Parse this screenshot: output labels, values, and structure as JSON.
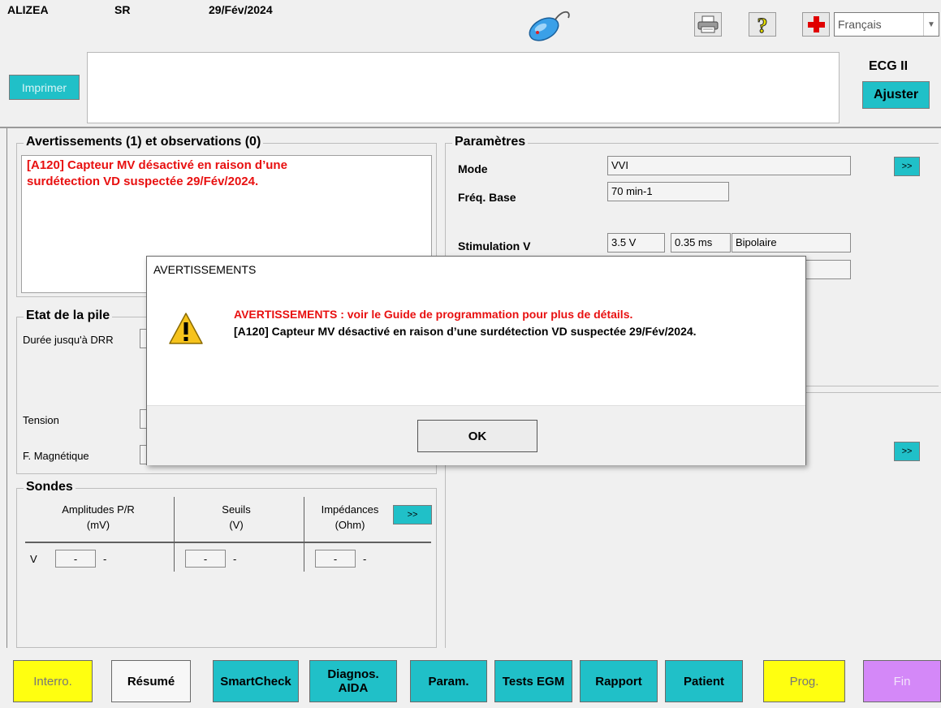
{
  "header": {
    "device_name": "ALIZEA",
    "mode_short": "SR",
    "date": "29/Fév/2024",
    "language": "Français"
  },
  "ecg": {
    "print_label": "Imprimer",
    "lead_label": "ECG II",
    "adjust_label": "Ajuster"
  },
  "warnings": {
    "title": "Avertissements (1) et observations (0)",
    "text_line1": "[A120] Capteur MV désactivé en raison d’une",
    "text_line2": "surdétection VD suspectée 29/Fév/2024."
  },
  "parameters": {
    "title": "Paramètres",
    "expand_label": ">>",
    "mode_label": "Mode",
    "mode_value": "VVI",
    "rate_label": "Fréq. Base",
    "rate_value": "70 min-1",
    "pacing_label": "Stimulation V",
    "pacing_amplitude": "3.5 V",
    "pacing_width": "0.35 ms",
    "pacing_polarity": "Bipolaire"
  },
  "battery": {
    "title": "Etat de la pile",
    "time_to_eri_label": "Durée jusqu'à DRR",
    "voltage_label": "Tension",
    "magnet_label": "F. Magnétique"
  },
  "leads": {
    "title": "Sondes",
    "col_amplitudes": "Amplitudes P/R",
    "col_amplitudes_unit": "(mV)",
    "col_thresholds": "Seuils",
    "col_thresholds_unit": "(V)",
    "col_impedances": "Impédances",
    "col_impedances_unit": "(Ohm)",
    "expand_label": ">>",
    "row_label": "V",
    "amp_value": "-",
    "amp_extra": "-",
    "thr_value": "-",
    "thr_extra": "-",
    "imp_value": "-",
    "imp_extra": "-"
  },
  "right_lower": {
    "expand_label": ">>"
  },
  "dialog": {
    "title": "AVERTISSEMENTS",
    "headline": "AVERTISSEMENTS : voir le Guide de programmation pour plus de détails.",
    "message": "[A120] Capteur MV désactivé en raison d’une surdétection VD suspectée 29/Fév/2024.",
    "ok_label": "OK"
  },
  "nav": {
    "interro": "Interro.",
    "resume": "Résumé",
    "smartcheck": "SmartCheck",
    "diagnos_line1": "Diagnos.",
    "diagnos_line2": "AIDA",
    "param": "Param.",
    "tests_egm": "Tests EGM",
    "rapport": "Rapport",
    "patient": "Patient",
    "prog": "Prog.",
    "fin": "Fin"
  },
  "colors": {
    "accent_cyan": "#20c0c8",
    "warning_red": "#e81010",
    "nav_yellow": "#ffff10",
    "nav_violet": "#d488f8"
  },
  "icons": [
    "telemetry-wand-icon",
    "printer-icon",
    "help-icon",
    "medical-cross-icon",
    "warning-icon"
  ]
}
